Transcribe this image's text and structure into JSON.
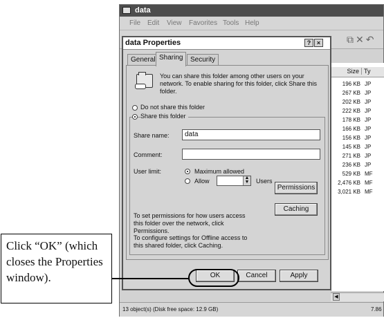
{
  "explorer": {
    "title": "data",
    "menu": [
      "File",
      "Edit",
      "View",
      "Favorites",
      "Tools",
      "Help"
    ],
    "columns": {
      "size": "Size",
      "type": "Ty"
    },
    "rows": [
      {
        "size": "196 KB",
        "type": "JP"
      },
      {
        "size": "267 KB",
        "type": "JP"
      },
      {
        "size": "202 KB",
        "type": "JP"
      },
      {
        "size": "222 KB",
        "type": "JP"
      },
      {
        "size": "178 KB",
        "type": "JP"
      },
      {
        "size": "166 KB",
        "type": "JP"
      },
      {
        "size": "156 KB",
        "type": "JP"
      },
      {
        "size": "145 KB",
        "type": "JP"
      },
      {
        "size": "271 KB",
        "type": "JP"
      },
      {
        "size": "236 KB",
        "type": "JP"
      },
      {
        "size": "529 KB",
        "type": "MF"
      },
      {
        "size": "2,476 KB",
        "type": "MF"
      },
      {
        "size": "3,021 KB",
        "type": "MF"
      }
    ],
    "status": "13 object(s) (Disk free space: 12.9 GB)",
    "status_right": "7.86"
  },
  "dialog": {
    "title": "data Properties",
    "help": "?",
    "close": "×",
    "tabs": {
      "general": "General",
      "sharing": "Sharing",
      "security": "Security"
    },
    "info": "You can share this folder among other users on your network.  To enable sharing for this folder, click Share this folder.",
    "radio_no_share": "Do not share this folder",
    "radio_share": "Share this folder",
    "share_name_label": "Share name:",
    "share_name_value": "data",
    "comment_label": "Comment:",
    "comment_value": "",
    "user_limit_label": "User limit:",
    "max_allowed": "Maximum allowed",
    "allow": "Allow",
    "users": "Users",
    "perm_text": "To set permissions for how users access this folder over the network, click Permissions.",
    "perm_button": "Permissions",
    "cache_text": "To configure settings for Offline access to this shared folder, click Caching.",
    "cache_button": "Caching",
    "ok": "OK",
    "cancel": "Cancel",
    "apply": "Apply"
  },
  "callout": {
    "text": "Click “OK” (which closes the Properties window)."
  }
}
